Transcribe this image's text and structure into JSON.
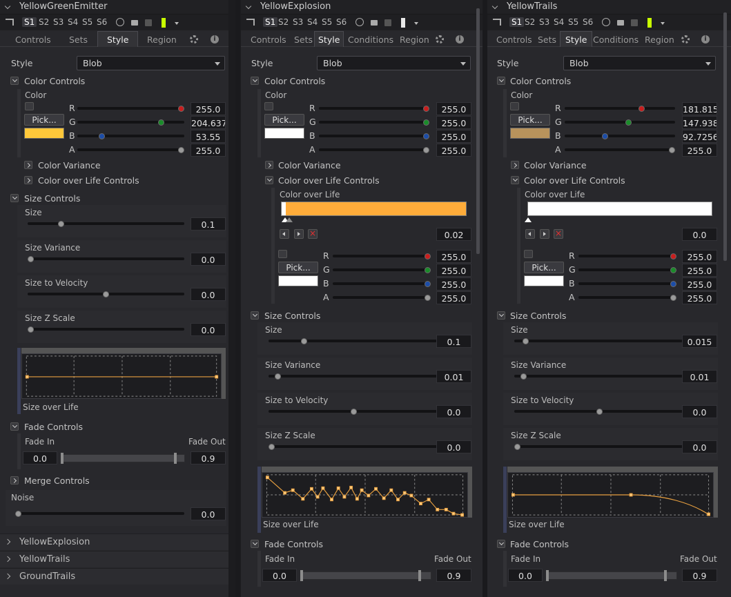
{
  "toolbar": {
    "sets": [
      "S1",
      "S2",
      "S3",
      "S4",
      "S5",
      "S6"
    ]
  },
  "collapsed_nodes": [
    "YellowExplosion",
    "YellowTrails",
    "GroundTrails"
  ],
  "panels": [
    {
      "title": "YellowGreenEmitter",
      "tabs": [
        "Controls",
        "Sets",
        "Style",
        "Region"
      ],
      "active_tab": "Style",
      "style_label": "Style",
      "style_value": "Blob",
      "color_section": "Color Controls",
      "color_label": "Color",
      "pick_label": "Pick...",
      "swatch_color": "#ffc83a",
      "rgba_labels": [
        "R",
        "G",
        "B",
        "A"
      ],
      "rgba": [
        "255.0",
        "204.6375",
        "53.55",
        "255.0"
      ],
      "rgba_fraction": [
        1.0,
        0.8025,
        0.21,
        1.0
      ],
      "color_variance": "Color Variance",
      "color_over_life_controls": "Color over Life Controls",
      "size_section": "Size Controls",
      "size_rows": [
        {
          "label": "Size",
          "value": "0.1"
        },
        {
          "label": "Size Variance",
          "value": "0.0"
        },
        {
          "label": "Size to Velocity",
          "value": "0.0"
        },
        {
          "label": "Size Z Scale",
          "value": "0.0"
        }
      ],
      "size_over_life": "Size over Life",
      "fade_section": "Fade Controls",
      "fade_in_label": "Fade In",
      "fade_out_label": "Fade Out",
      "fade_in": "0.0",
      "fade_out": "0.9",
      "merge_section": "Merge Controls",
      "noise_label": "Noise",
      "noise_value": "0.0"
    },
    {
      "title": "YellowExplosion",
      "tabs": [
        "Controls",
        "Sets",
        "Style",
        "Conditions",
        "Region"
      ],
      "active_tab": "Style",
      "style_label": "Style",
      "style_value": "Blob",
      "color_section": "Color Controls",
      "color_label": "Color",
      "pick_label": "Pick...",
      "swatch_color": "#ffffff",
      "rgba_labels": [
        "R",
        "G",
        "B",
        "A"
      ],
      "rgba": [
        "255.0",
        "255.0",
        "255.0",
        "255.0"
      ],
      "color_variance": "Color Variance",
      "color_over_life_controls": "Color over Life Controls",
      "color_over_life": "Color over Life",
      "gradient_color": "#ffac3a",
      "gradient_value": "0.02",
      "col_rgba": [
        "255.0",
        "255.0",
        "255.0",
        "255.0"
      ],
      "size_section": "Size Controls",
      "size_rows": [
        {
          "label": "Size",
          "value": "0.1"
        },
        {
          "label": "Size Variance",
          "value": "0.01"
        },
        {
          "label": "Size to Velocity",
          "value": "0.0"
        },
        {
          "label": "Size Z Scale",
          "value": "0.0"
        }
      ],
      "size_over_life": "Size over Life",
      "fade_section": "Fade Controls",
      "fade_in_label": "Fade In",
      "fade_out_label": "Fade Out",
      "fade_in": "0.0",
      "fade_out": "0.9"
    },
    {
      "title": "YellowTrails",
      "tabs": [
        "Controls",
        "Sets",
        "Style",
        "Conditions",
        "Region"
      ],
      "active_tab": "Style",
      "style_label": "Style",
      "style_value": "Blob",
      "color_section": "Color Controls",
      "color_label": "Color",
      "pick_label": "Pick...",
      "swatch_color": "#b8935c",
      "rgba_labels": [
        "R",
        "G",
        "B",
        "A"
      ],
      "rgba": [
        "181.815",
        "147.9383",
        "92.72565",
        "255.0"
      ],
      "color_variance": "Color Variance",
      "color_over_life_controls": "Color over Life Controls",
      "color_over_life": "Color over Life",
      "gradient_color": "#ffffff",
      "gradient_value": "0.0",
      "col_rgba": [
        "255.0",
        "255.0",
        "255.0",
        "255.0"
      ],
      "size_section": "Size Controls",
      "size_rows": [
        {
          "label": "Size",
          "value": "0.015"
        },
        {
          "label": "Size Variance",
          "value": "0.01"
        },
        {
          "label": "Size to Velocity",
          "value": "0.0"
        },
        {
          "label": "Size Z Scale",
          "value": "0.0"
        }
      ],
      "size_over_life": "Size over Life",
      "fade_section": "Fade Controls",
      "fade_in_label": "Fade In",
      "fade_out_label": "Fade Out",
      "fade_in": "0.0",
      "fade_out": "0.9"
    }
  ]
}
